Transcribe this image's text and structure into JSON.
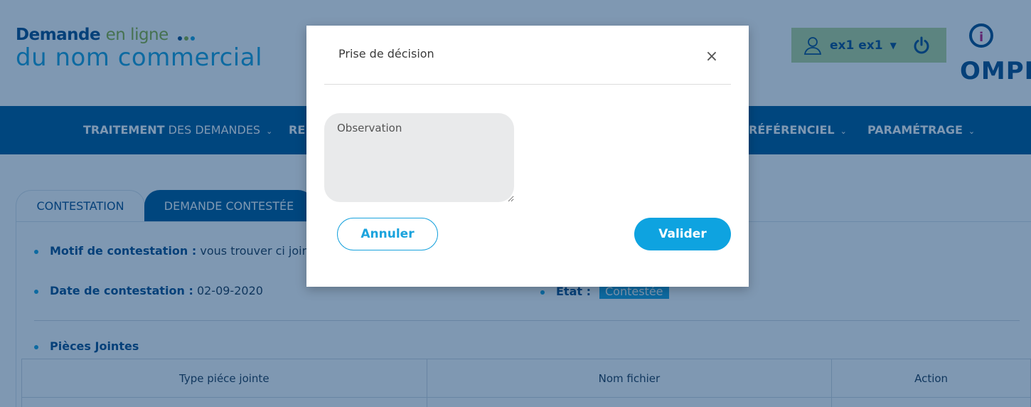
{
  "header": {
    "logo_line1_part1": "Demande",
    "logo_line1_part2": "en ligne",
    "logo_line2": "du nom commercial",
    "user_name": "ex1 ex1",
    "brand": "OMPIC"
  },
  "nav": {
    "item1_bold": "TRAITEMENT",
    "item1_rest": "DES DEMANDES",
    "item2": "RE",
    "item3": "RÉFÉRENCIEL",
    "item4": "PARAMÉTRAGE"
  },
  "tabs": {
    "active": "CONTESTATION",
    "inactive": "DEMANDE CONTESTÉE"
  },
  "details": {
    "motif_label": "Motif de contestation :",
    "motif_value": "vous trouver ci joint une",
    "date_label": "Date de contestation :",
    "date_value": "02-09-2020",
    "etat_label": "Etat :",
    "etat_value": "Contestée",
    "pieces_label": "Pièces Jointes"
  },
  "table": {
    "headers": [
      "Type piéce jointe",
      "Nom fichier",
      "Action"
    ]
  },
  "modal": {
    "title": "Prise de décision",
    "close": "×",
    "observation_placeholder": "Observation",
    "cancel_label": "Annuler",
    "validate_label": "Valider"
  },
  "colors": {
    "primary": "#005a96",
    "accent": "#1aa3dd",
    "user_box": "#b9d79a"
  },
  "icons": {
    "user": "user-icon",
    "power": "power-icon",
    "close": "close-icon",
    "caret": "caret-down-icon"
  }
}
